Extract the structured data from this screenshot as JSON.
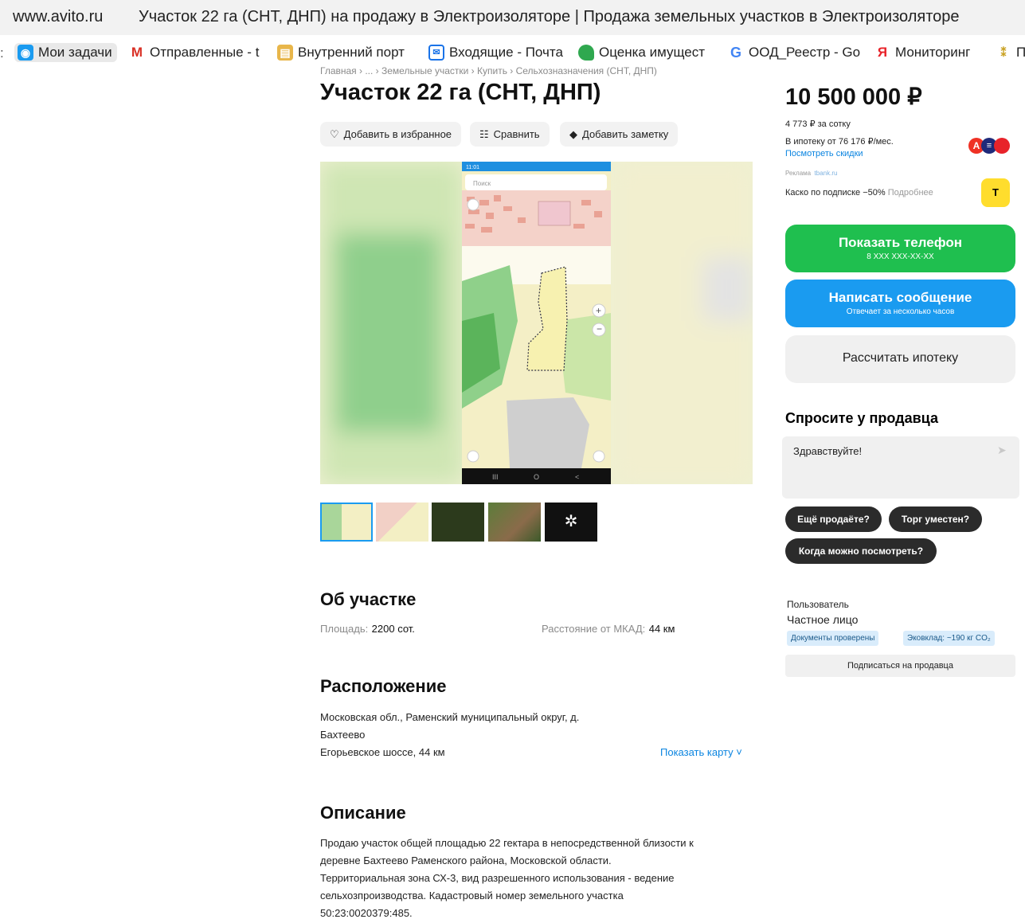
{
  "browser": {
    "domain": "www.avito.ru",
    "title": "Участок 22 га (СНТ, ДНП) на продажу в Электроизоляторе | Продажа земельных участков в Электроизоляторе",
    "bookmarks": [
      {
        "label": "Мои задачи",
        "icon": "tasks-icon"
      },
      {
        "label": "Отправленные - t",
        "icon": "gmail-icon"
      },
      {
        "label": "Внутренний порт",
        "icon": "portal-icon"
      },
      {
        "label": "Входящие - Почта",
        "icon": "mail-icon"
      },
      {
        "label": "Оценка имущест",
        "icon": "drive-icon"
      },
      {
        "label": "ООД_Реестр - Go",
        "icon": "google-icon"
      },
      {
        "label": "Мониторинг",
        "icon": "yandex-market-icon"
      },
      {
        "label": "П",
        "icon": "bookmark-icon"
      }
    ]
  },
  "breadcrumb": "Главная › ... › Земельные участки › Купить › Сельхозназначения (СНТ, ДНП)",
  "title": "Участок 22 га (СНТ, ДНП)",
  "actions": {
    "favorite": "Добавить в избранное",
    "compare": "Сравнить",
    "note": "Добавить заметку"
  },
  "map_screenshot": {
    "status_left": "11:01",
    "search_placeholder": "Поиск"
  },
  "about": {
    "heading": "Об участке",
    "area_label": "Площадь:",
    "area_value": "2200 сот.",
    "distance_label": "Расстояние от МКАД:",
    "distance_value": "44 км"
  },
  "location": {
    "heading": "Расположение",
    "address_line1": "Московская обл., Раменский муниципальный округ, д.",
    "address_line2": "Бахтеево",
    "highway": "Егорьевское шоссе, 44 км",
    "show_map": "Показать карту ˅"
  },
  "description": {
    "heading": "Описание",
    "lines": [
      "Продаю участок общей площадью 22 гектара в непосредственной близости к",
      "деревне Бахтеево Раменского района, Московской области.",
      "Территориальная зона СХ-3, вид разрешенного использования - ведение",
      "сельхозпроизводства. Кадастровый номер земельного участка",
      "50:23:0020379:485."
    ]
  },
  "sidebar": {
    "price": "10 500 000 ₽",
    "per_sotka": "4 773 ₽ за сотку",
    "mortgage": "В ипотеку от 76 176 ₽/мес.",
    "discounts": "Посмотреть скидки",
    "ad_label": "Реклама",
    "ad_source": "tbank.ru",
    "kasko": "Каско по подписке −50%",
    "kasko_more": "Подробнее",
    "show_phone": "Показать телефон",
    "phone_mask": "8 XXX XXX-XX-XX",
    "write_message": "Написать сообщение",
    "reply_time": "Отвечает за несколько часов",
    "calc_mortgage": "Рассчитать ипотеку",
    "ask_heading": "Спросите у продавца",
    "message_value": "Здравствуйте!",
    "chips": [
      "Ещё продаёте?",
      "Торг уместен?",
      "Когда можно посмотреть?"
    ],
    "seller_type": "Пользователь",
    "seller_name": "Частное лицо",
    "badge_docs": "Документы проверены",
    "badge_eco": "Эковклад: ~190 кг CO₂",
    "subscribe": "Подписаться на продавца",
    "colors": {
      "green": "#1fbf4f",
      "blue": "#1a9bf0",
      "gray": "#f0f0f0"
    }
  }
}
